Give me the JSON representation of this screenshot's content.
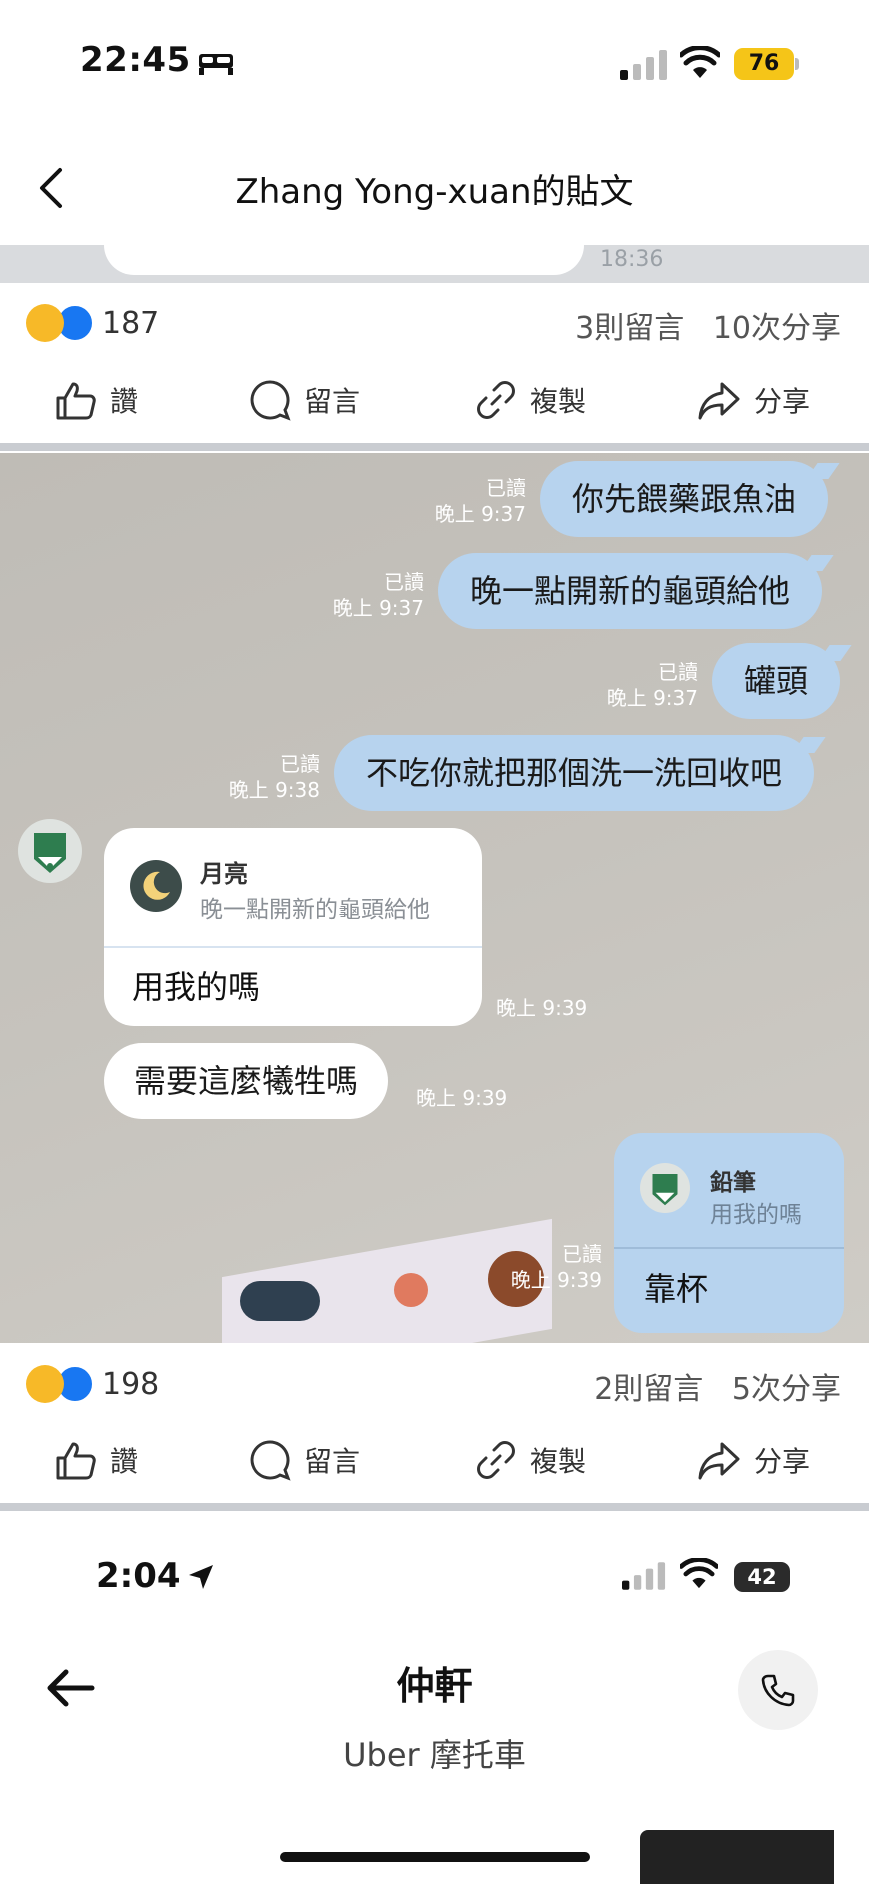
{
  "status_bar": {
    "time": "22:45",
    "battery": "76"
  },
  "header": {
    "title": "Zhang Yong-xuan的貼文"
  },
  "top_crop": {
    "time": "18:36"
  },
  "post1": {
    "reaction_count": "187",
    "comments": "3則留言",
    "shares": "10次分享"
  },
  "actions": {
    "like": "讚",
    "comment": "留言",
    "copy": "複製",
    "share": "分享"
  },
  "chat": {
    "messages": [
      {
        "text": "你先餵藥跟魚油",
        "read": "已讀",
        "time": "晚上 9:37"
      },
      {
        "text": "晚一點開新的龜頭給他",
        "read": "已讀",
        "time": "晚上 9:37"
      },
      {
        "text": "罐頭",
        "read": "已讀",
        "time": "晚上 9:37"
      },
      {
        "text": "不吃你就把那個洗一洗回收吧",
        "read": "已讀",
        "time": "晚上 9:38"
      }
    ],
    "incoming_reply": {
      "quoted_name": "月亮",
      "quoted_text": "晚一點開新的龜頭給他",
      "text": "用我的嗎",
      "time": "晚上 9:39"
    },
    "incoming_msg": {
      "text": "需要這麼犧牲嗎",
      "time": "晚上 9:39"
    },
    "outgoing_reply": {
      "quoted_name": "鉛筆",
      "quoted_text": "用我的嗎",
      "text": "靠杯",
      "read": "已讀",
      "time": "晚上 9:39"
    }
  },
  "post2": {
    "reaction_count": "198",
    "comments": "2則留言",
    "shares": "5次分享"
  },
  "bottom": {
    "time": "2:04",
    "battery": "42",
    "title": "仲軒",
    "subtitle": "Uber 摩托車"
  }
}
